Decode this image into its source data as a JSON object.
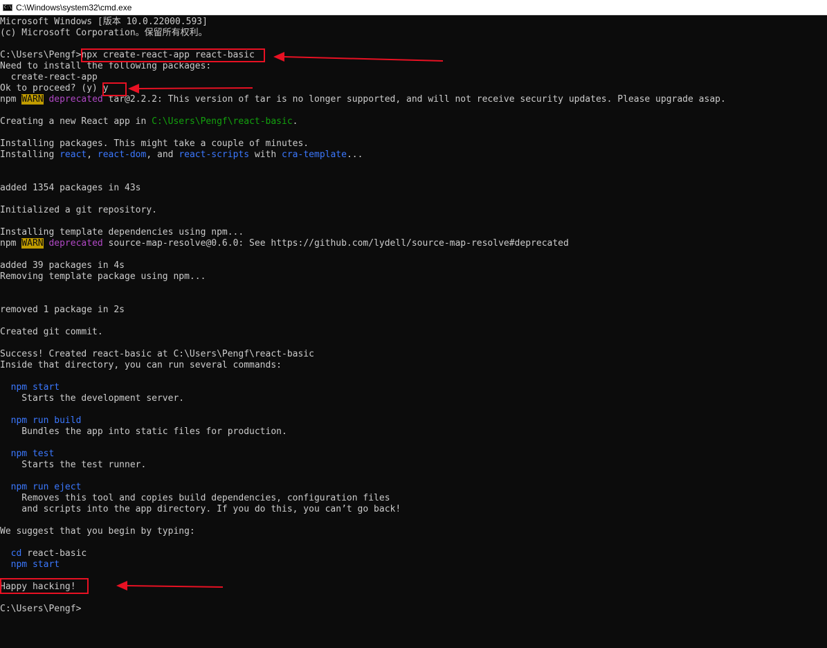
{
  "window": {
    "title": "C:\\Windows\\system32\\cmd.exe",
    "icon": "console-app-icon"
  },
  "console": {
    "lines": [
      [
        {
          "t": "Microsoft Windows [版本 10.0.22000.593]"
        }
      ],
      [
        {
          "t": "(c) Microsoft Corporation。保留所有权利。"
        }
      ],
      [
        {
          "t": ""
        }
      ],
      [
        {
          "t": "C:\\Users\\Pengf>npx create-react-app react-basic"
        }
      ],
      [
        {
          "t": "Need to install the following packages:"
        }
      ],
      [
        {
          "t": "  create-react-app"
        }
      ],
      [
        {
          "t": "Ok to proceed? (y) y"
        }
      ],
      [
        {
          "t": "npm "
        },
        {
          "t": "WARN",
          "c": "warn"
        },
        {
          "t": " "
        },
        {
          "t": "deprecated",
          "c": "magenta"
        },
        {
          "t": " tar@2.2.2: This version of tar is no longer supported, and will not receive security updates. Please upgrade asap."
        }
      ],
      [
        {
          "t": ""
        }
      ],
      [
        {
          "t": "Creating a new React app in "
        },
        {
          "t": "C:\\Users\\Pengf\\react-basic",
          "c": "green"
        },
        {
          "t": "."
        }
      ],
      [
        {
          "t": ""
        }
      ],
      [
        {
          "t": "Installing packages. This might take a couple of minutes."
        }
      ],
      [
        {
          "t": "Installing "
        },
        {
          "t": "react",
          "c": "blue"
        },
        {
          "t": ", "
        },
        {
          "t": "react-dom",
          "c": "blue"
        },
        {
          "t": ", and "
        },
        {
          "t": "react-scripts",
          "c": "blue"
        },
        {
          "t": " with "
        },
        {
          "t": "cra-template",
          "c": "blue"
        },
        {
          "t": "..."
        }
      ],
      [
        {
          "t": ""
        }
      ],
      [
        {
          "t": ""
        }
      ],
      [
        {
          "t": "added 1354 packages in 43s"
        }
      ],
      [
        {
          "t": ""
        }
      ],
      [
        {
          "t": "Initialized a git repository."
        }
      ],
      [
        {
          "t": ""
        }
      ],
      [
        {
          "t": "Installing template dependencies using npm..."
        }
      ],
      [
        {
          "t": "npm "
        },
        {
          "t": "WARN",
          "c": "warn"
        },
        {
          "t": " "
        },
        {
          "t": "deprecated",
          "c": "magenta"
        },
        {
          "t": " source-map-resolve@0.6.0: See https://github.com/lydell/source-map-resolve#deprecated"
        }
      ],
      [
        {
          "t": ""
        }
      ],
      [
        {
          "t": "added 39 packages in 4s"
        }
      ],
      [
        {
          "t": "Removing template package using npm..."
        }
      ],
      [
        {
          "t": ""
        }
      ],
      [
        {
          "t": ""
        }
      ],
      [
        {
          "t": "removed 1 package in 2s"
        }
      ],
      [
        {
          "t": ""
        }
      ],
      [
        {
          "t": "Created git commit."
        }
      ],
      [
        {
          "t": ""
        }
      ],
      [
        {
          "t": "Success! Created react-basic at C:\\Users\\Pengf\\react-basic"
        }
      ],
      [
        {
          "t": "Inside that directory, you can run several commands:"
        }
      ],
      [
        {
          "t": ""
        }
      ],
      [
        {
          "t": "  "
        },
        {
          "t": "npm start",
          "c": "blue"
        }
      ],
      [
        {
          "t": "    Starts the development server."
        }
      ],
      [
        {
          "t": ""
        }
      ],
      [
        {
          "t": "  "
        },
        {
          "t": "npm run build",
          "c": "blue"
        }
      ],
      [
        {
          "t": "    Bundles the app into static files for production."
        }
      ],
      [
        {
          "t": ""
        }
      ],
      [
        {
          "t": "  "
        },
        {
          "t": "npm test",
          "c": "blue"
        }
      ],
      [
        {
          "t": "    Starts the test runner."
        }
      ],
      [
        {
          "t": ""
        }
      ],
      [
        {
          "t": "  "
        },
        {
          "t": "npm run eject",
          "c": "blue"
        }
      ],
      [
        {
          "t": "    Removes this tool and copies build dependencies, configuration files"
        }
      ],
      [
        {
          "t": "    and scripts into the app directory. If you do this, you can’t go back!"
        }
      ],
      [
        {
          "t": ""
        }
      ],
      [
        {
          "t": "We suggest that you begin by typing:"
        }
      ],
      [
        {
          "t": ""
        }
      ],
      [
        {
          "t": "  "
        },
        {
          "t": "cd",
          "c": "blue"
        },
        {
          "t": " react-basic"
        }
      ],
      [
        {
          "t": "  "
        },
        {
          "t": "npm start",
          "c": "blue"
        }
      ],
      [
        {
          "t": ""
        }
      ],
      [
        {
          "t": "Happy hacking!"
        }
      ],
      [
        {
          "t": ""
        }
      ],
      [
        {
          "t": "C:\\Users\\Pengf>"
        }
      ]
    ]
  },
  "colors": {
    "background": "#0c0c0c",
    "foreground": "#cccccc",
    "blue": "#3b78ff",
    "green": "#13a10e",
    "magenta": "#b148c6",
    "warn_bg": "#c19c00",
    "annotation": "#e81123"
  }
}
